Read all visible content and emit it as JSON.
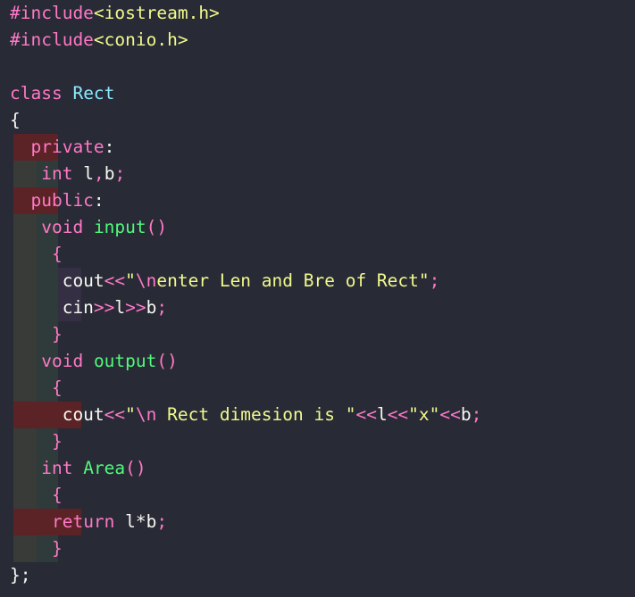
{
  "editor": {
    "language": "C++",
    "theme": {
      "background": "#282a36",
      "foreground": "#f8f8f2",
      "keyword": "#ff79c6",
      "string": "#f1fa8c",
      "function": "#50fa7b",
      "type": "#8be9fd",
      "indent_guide_1": "#383b37",
      "indent_guide_2": "#2f3a3a",
      "indent_guide_3": "#342f43",
      "highlight_row": "#5c2327"
    },
    "lines": [
      {
        "n": 1,
        "guides": 0,
        "highlight": "none",
        "tokens": [
          {
            "t": "#include",
            "c": "pink"
          },
          {
            "t": "<iostream.h>",
            "c": "yellow"
          }
        ]
      },
      {
        "n": 2,
        "guides": 0,
        "highlight": "none",
        "tokens": [
          {
            "t": "#include",
            "c": "pink"
          },
          {
            "t": "<conio.h>",
            "c": "yellow"
          }
        ]
      },
      {
        "n": 3,
        "guides": 0,
        "highlight": "none",
        "tokens": [
          {
            "t": "",
            "c": "white"
          }
        ]
      },
      {
        "n": 4,
        "guides": 0,
        "highlight": "none",
        "tokens": [
          {
            "t": "class",
            "c": "pink"
          },
          {
            "t": " ",
            "c": "white"
          },
          {
            "t": "Rect",
            "c": "cyan"
          }
        ]
      },
      {
        "n": 5,
        "guides": 0,
        "highlight": "none",
        "tokens": [
          {
            "t": "{",
            "c": "white"
          }
        ]
      },
      {
        "n": 6,
        "guides": 1,
        "highlight": "narrow",
        "tokens": [
          {
            "t": "  private",
            "c": "pink"
          },
          {
            "t": ":",
            "c": "white"
          }
        ]
      },
      {
        "n": 7,
        "guides": 2,
        "highlight": "none",
        "tokens": [
          {
            "t": "   int",
            "c": "pink"
          },
          {
            "t": " l",
            "c": "white"
          },
          {
            "t": ",",
            "c": "pink"
          },
          {
            "t": "b",
            "c": "white"
          },
          {
            "t": ";",
            "c": "pink"
          }
        ]
      },
      {
        "n": 8,
        "guides": 1,
        "highlight": "narrow",
        "tokens": [
          {
            "t": "  public",
            "c": "pink"
          },
          {
            "t": ":",
            "c": "white"
          }
        ]
      },
      {
        "n": 9,
        "guides": 2,
        "highlight": "none",
        "tokens": [
          {
            "t": "   void",
            "c": "pink"
          },
          {
            "t": " ",
            "c": "white"
          },
          {
            "t": "input",
            "c": "green"
          },
          {
            "t": "()",
            "c": "pink"
          }
        ]
      },
      {
        "n": 10,
        "guides": 2,
        "highlight": "none",
        "tokens": [
          {
            "t": "    ",
            "c": "white"
          },
          {
            "t": "{",
            "c": "pink"
          }
        ]
      },
      {
        "n": 11,
        "guides": 3,
        "highlight": "none",
        "tokens": [
          {
            "t": "     cout",
            "c": "white"
          },
          {
            "t": "<<",
            "c": "pink"
          },
          {
            "t": "\"",
            "c": "yellow"
          },
          {
            "t": "\\n",
            "c": "pink"
          },
          {
            "t": "enter Len and Bre of Rect\"",
            "c": "yellow"
          },
          {
            "t": ";",
            "c": "pink"
          }
        ]
      },
      {
        "n": 12,
        "guides": 3,
        "highlight": "none",
        "tokens": [
          {
            "t": "     cin",
            "c": "white"
          },
          {
            "t": ">>",
            "c": "pink"
          },
          {
            "t": "l",
            "c": "white"
          },
          {
            "t": ">>",
            "c": "pink"
          },
          {
            "t": "b",
            "c": "white"
          },
          {
            "t": ";",
            "c": "pink"
          }
        ]
      },
      {
        "n": 13,
        "guides": 2,
        "highlight": "none",
        "tokens": [
          {
            "t": "    ",
            "c": "white"
          },
          {
            "t": "}",
            "c": "pink"
          }
        ]
      },
      {
        "n": 14,
        "guides": 2,
        "highlight": "none",
        "tokens": [
          {
            "t": "   void",
            "c": "pink"
          },
          {
            "t": " ",
            "c": "white"
          },
          {
            "t": "output",
            "c": "green"
          },
          {
            "t": "()",
            "c": "pink"
          }
        ]
      },
      {
        "n": 15,
        "guides": 2,
        "highlight": "none",
        "tokens": [
          {
            "t": "    ",
            "c": "white"
          },
          {
            "t": "{",
            "c": "pink"
          }
        ]
      },
      {
        "n": 16,
        "guides": 2,
        "highlight": "wide",
        "tokens": [
          {
            "t": "     cout",
            "c": "white"
          },
          {
            "t": "<<",
            "c": "pink"
          },
          {
            "t": "\"",
            "c": "yellow"
          },
          {
            "t": "\\n",
            "c": "pink"
          },
          {
            "t": " Rect dimesion is \"",
            "c": "yellow"
          },
          {
            "t": "<<",
            "c": "pink"
          },
          {
            "t": "l",
            "c": "white"
          },
          {
            "t": "<<",
            "c": "pink"
          },
          {
            "t": "\"x\"",
            "c": "yellow"
          },
          {
            "t": "<<",
            "c": "pink"
          },
          {
            "t": "b",
            "c": "white"
          },
          {
            "t": ";",
            "c": "pink"
          }
        ]
      },
      {
        "n": 17,
        "guides": 2,
        "highlight": "none",
        "tokens": [
          {
            "t": "    ",
            "c": "white"
          },
          {
            "t": "}",
            "c": "pink"
          }
        ]
      },
      {
        "n": 18,
        "guides": 2,
        "highlight": "none",
        "tokens": [
          {
            "t": "   int",
            "c": "pink"
          },
          {
            "t": " ",
            "c": "white"
          },
          {
            "t": "Area",
            "c": "green"
          },
          {
            "t": "()",
            "c": "pink"
          }
        ]
      },
      {
        "n": 19,
        "guides": 2,
        "highlight": "none",
        "tokens": [
          {
            "t": "    ",
            "c": "white"
          },
          {
            "t": "{",
            "c": "pink"
          }
        ]
      },
      {
        "n": 20,
        "guides": 2,
        "highlight": "wide",
        "tokens": [
          {
            "t": "    ",
            "c": "white"
          },
          {
            "t": "return",
            "c": "pink"
          },
          {
            "t": " l*b",
            "c": "white"
          },
          {
            "t": ";",
            "c": "pink"
          }
        ]
      },
      {
        "n": 21,
        "guides": 2,
        "highlight": "none",
        "tokens": [
          {
            "t": "    ",
            "c": "white"
          },
          {
            "t": "}",
            "c": "pink"
          }
        ]
      },
      {
        "n": 22,
        "guides": 0,
        "highlight": "none",
        "tokens": [
          {
            "t": "};",
            "c": "white"
          }
        ]
      }
    ]
  }
}
